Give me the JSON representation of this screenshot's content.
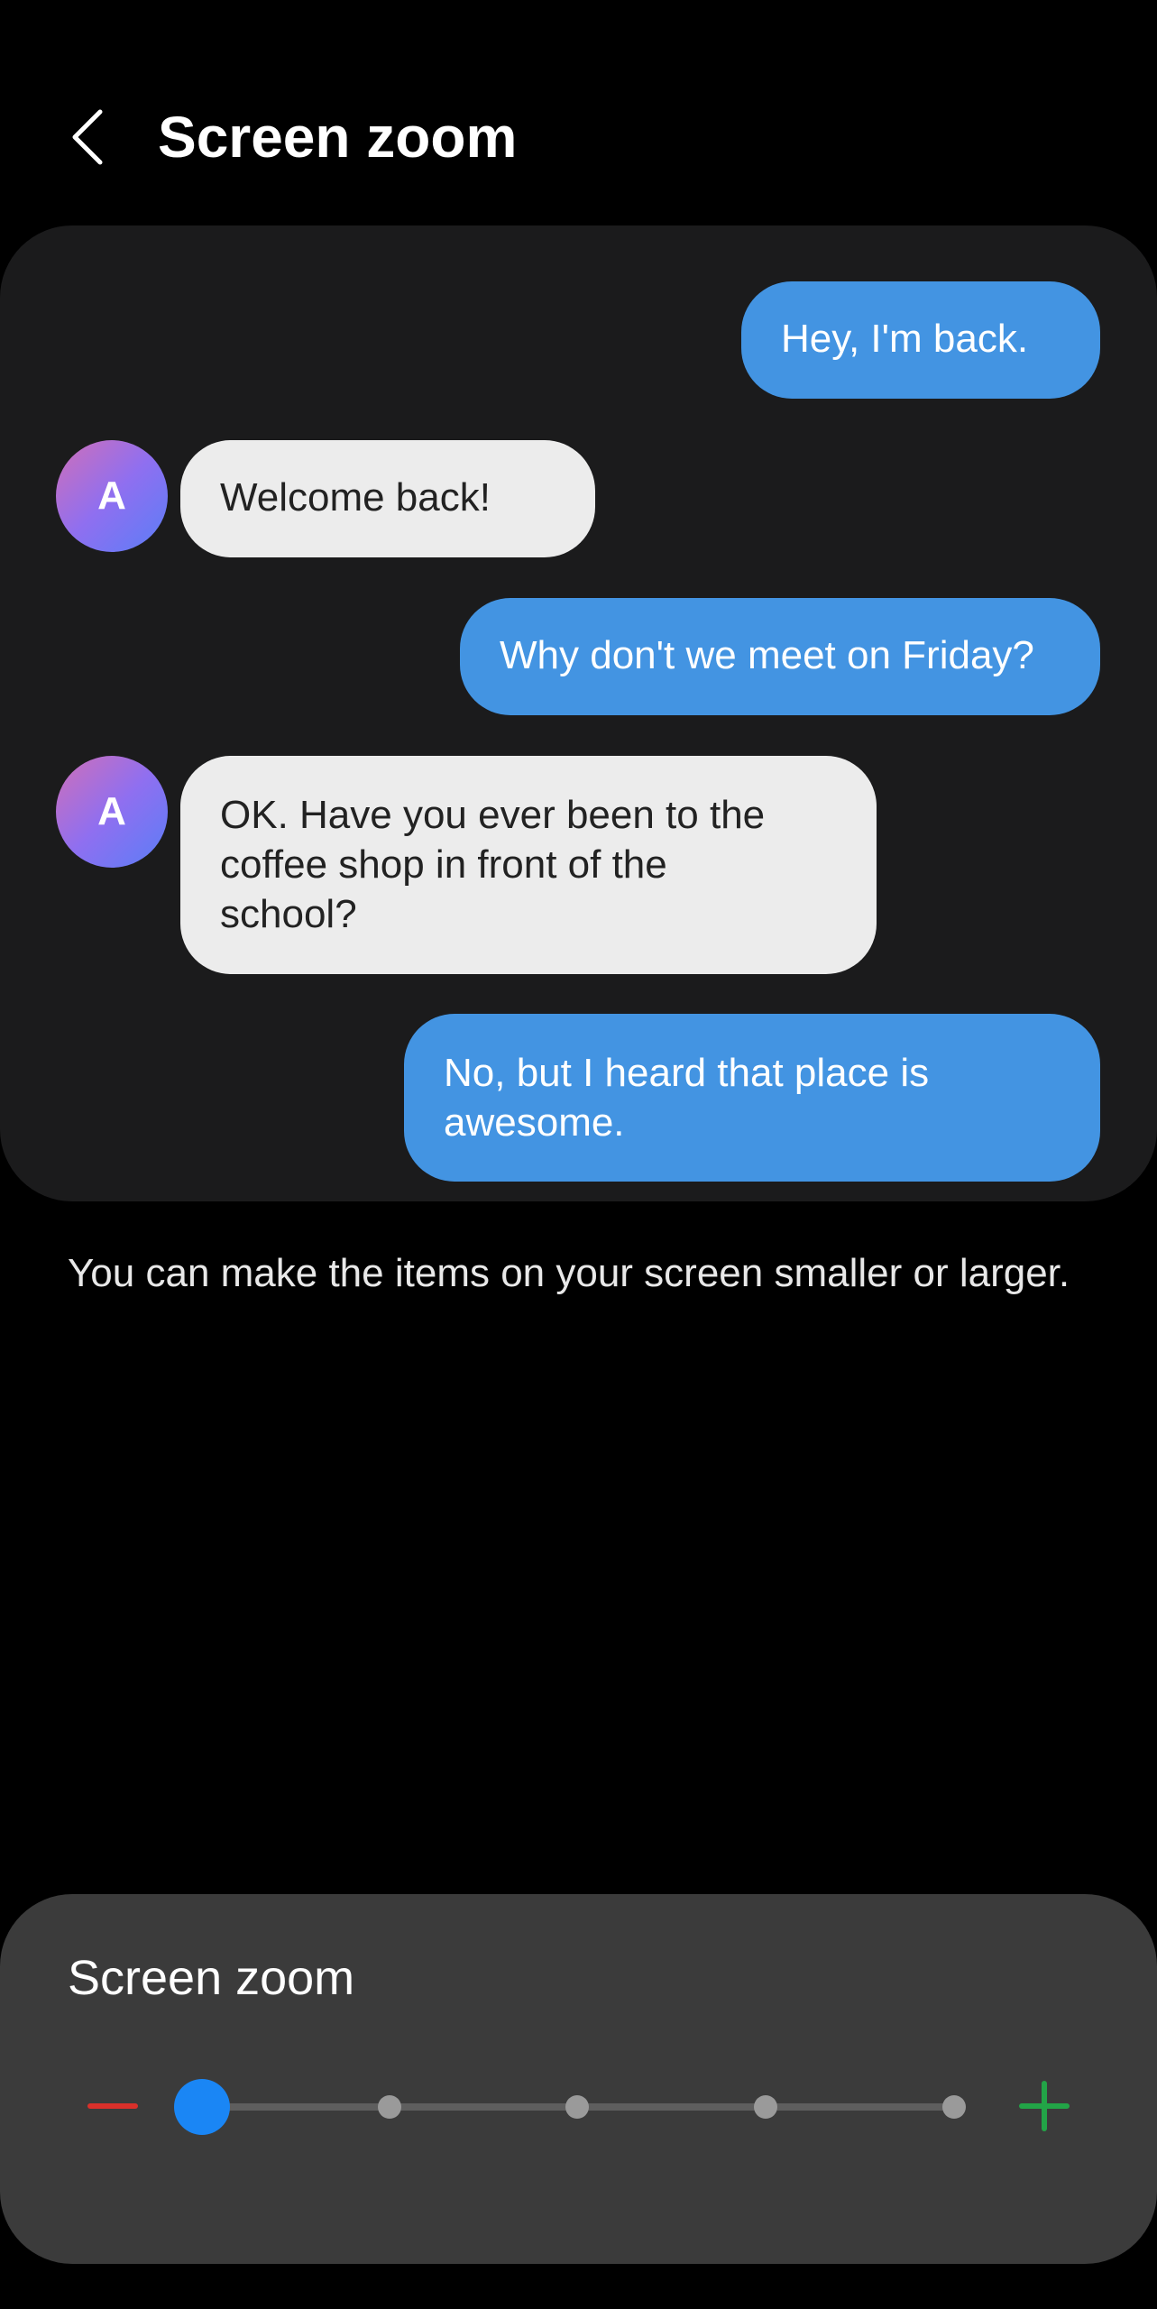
{
  "header": {
    "title": "Screen zoom",
    "back_icon": "chevron-left-icon"
  },
  "preview": {
    "messages": [
      {
        "direction": "outgoing",
        "text": "Hey, I'm back."
      },
      {
        "direction": "incoming",
        "avatar": "A",
        "text": "Welcome back!"
      },
      {
        "direction": "outgoing",
        "text": "Why don't we meet on Friday?"
      },
      {
        "direction": "incoming",
        "avatar": "A",
        "text": "OK. Have you ever been to the coffee shop in front of the school?"
      },
      {
        "direction": "outgoing",
        "text": "No, but I heard that place is awesome."
      }
    ]
  },
  "description": "You can make the items on your screen smaller or larger.",
  "zoom": {
    "title": "Screen zoom",
    "levels": 5,
    "selected_level": 1,
    "minus_icon": "minus-icon",
    "plus_icon": "plus-icon"
  },
  "colors": {
    "outgoing_bubble": "#4394e2",
    "incoming_bubble": "#ececec",
    "slider_thumb": "#1a86f5",
    "minus": "#d9302a",
    "plus": "#22a447"
  }
}
